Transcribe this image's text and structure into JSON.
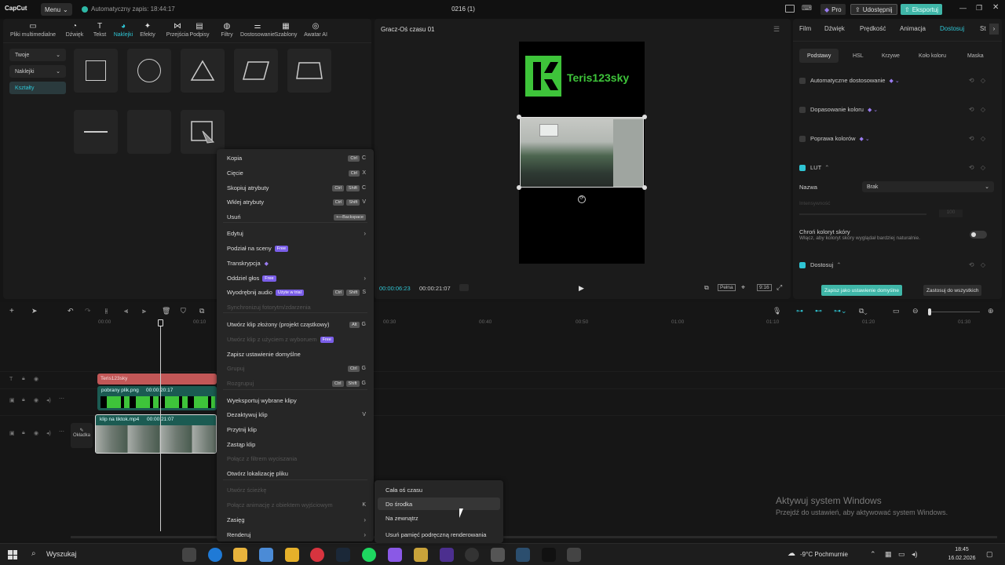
{
  "app": {
    "logo": "CapCut",
    "menu_label": "Menu",
    "autosave": "Automatyczny zapis: 18:44:17",
    "window_title": "0216 (1)",
    "pro_label": "Pro",
    "share_label": "Udostępnij",
    "export_label": "Eksportuj"
  },
  "tools": [
    {
      "label": "Pliki multimedialne",
      "icon": "media-icon"
    },
    {
      "label": "Dźwięk",
      "icon": "audio-icon"
    },
    {
      "label": "Tekst",
      "icon": "text-icon"
    },
    {
      "label": "Naklejki",
      "icon": "sticker-icon"
    },
    {
      "label": "Efekty",
      "icon": "effects-icon"
    },
    {
      "label": "Przejścia",
      "icon": "transitions-icon"
    },
    {
      "label": "Podpisy",
      "icon": "captions-icon"
    },
    {
      "label": "Filtry",
      "icon": "filters-icon"
    },
    {
      "label": "Dostosowanie",
      "icon": "adjust-icon"
    },
    {
      "label": "Szablony",
      "icon": "templates-icon"
    },
    {
      "label": "Awatar AI",
      "icon": "avatar-icon"
    }
  ],
  "sidebar": [
    {
      "label": "Twoje"
    },
    {
      "label": "Naklejki"
    },
    {
      "label": "Kształty"
    }
  ],
  "player": {
    "title": "Gracz-Oś czasu 01",
    "current_time": "00:00:06:23",
    "total_time": "00:00:21:07",
    "ratio": "9:16",
    "ratio_btn": "Pełna",
    "watermark": "Teris123sky"
  },
  "right": {
    "tabs": [
      "Film",
      "Dźwięk",
      "Prędkość",
      "Animacja",
      "Dostosuj",
      "St"
    ],
    "subtabs": [
      "Podstawy",
      "HSL",
      "Krzywe",
      "Koło koloru",
      "Maska"
    ],
    "rows": [
      {
        "label": "Automatyczne dostosowanie"
      },
      {
        "label": "Dopasowanie koloru"
      },
      {
        "label": "Poprawa kolorów"
      },
      {
        "label": "LUT"
      }
    ],
    "name_label": "Nazwa",
    "name_value": "Brak",
    "intensity_label": "Intensywność",
    "intensity_value": "100",
    "skin_title": "Chroń koloryt skóry",
    "skin_desc": "Włącz, aby koloryt skóry wyglądał bardziej naturalnie.",
    "adjust_label": "Dostosuj",
    "save_default": "Zapisz jako ustawienie domyślne",
    "apply_all": "Zastosuj do wszystkich"
  },
  "timeline": {
    "ticks": [
      "00:00",
      "00:10",
      "00:30",
      "00:40",
      "00:50",
      "01:00",
      "01:10",
      "01:20",
      "01:30"
    ],
    "text_clip": "Teris123sky",
    "image_clip": {
      "name": "pobrany plik.png",
      "duration": "00:00:20:17"
    },
    "video_clip": {
      "name": "klip na tiktok.mp4",
      "duration": "00:00:21:07"
    },
    "cover_label": "Okładka"
  },
  "context_menu": [
    {
      "label": "Kopia",
      "keys": [
        "Ctrl",
        "C"
      ]
    },
    {
      "label": "Cięcie",
      "keys": [
        "Ctrl",
        "X"
      ]
    },
    {
      "label": "Skopiuj atrybuty",
      "keys": [
        "Ctrl",
        "Shift",
        "C"
      ]
    },
    {
      "label": "Wklej atrybuty",
      "keys": [
        "Ctrl",
        "Shift",
        "V"
      ]
    },
    {
      "label": "Usuń",
      "keys": [
        "⟵Backspace"
      ]
    },
    {
      "label": "Edytuj"
    },
    {
      "label": "Podział na sceny",
      "badge": "Free"
    },
    {
      "label": "Transkrypcja"
    },
    {
      "label": "Oddziel głos",
      "badge": "Free"
    },
    {
      "label": "Wyodrębnij audio",
      "badge": "Użyte w trial",
      "keys": [
        "Ctrl",
        "Shift",
        "S"
      ]
    },
    {
      "label": "Synchronizuj fotorytm/zdarzenia"
    },
    {
      "label": "Utwórz klip złożony (projekt cząstkowy)",
      "keys": [
        "Alt",
        "G"
      ]
    },
    {
      "label": "Utwórz klip z użyciem z wyboruem",
      "badge": "Free"
    },
    {
      "label": "Zapisz ustawienie domyślne"
    },
    {
      "label": "Grupuj",
      "keys": [
        "Ctrl",
        "G"
      ]
    },
    {
      "label": "Rozgrupuj",
      "keys": [
        "Ctrl",
        "Shift",
        "G"
      ]
    },
    {
      "label": "Wyeksportuj wybrane klipy"
    },
    {
      "label": "Dezaktywuj klip",
      "keys": [
        "V"
      ]
    },
    {
      "label": "Przytnij klip"
    },
    {
      "label": "Zastąp klip"
    },
    {
      "label": "Połącz z filtrem wyciszania"
    },
    {
      "label": "Otwórz lokalizację pliku"
    },
    {
      "label": "Utwórz ścieżkę"
    },
    {
      "label": "Połącz animację z obiektem wyjściowym",
      "keys": [
        "K"
      ]
    },
    {
      "label": "Zasięg"
    },
    {
      "label": "Renderuj"
    }
  ],
  "render_submenu": [
    "Cała oś czasu",
    "Do środka",
    "Na zewnątrz",
    "Usuń pamięć podręczną renderowania"
  ],
  "windows": {
    "activate_title": "Aktywuj system Windows",
    "activate_desc": "Przejdź do ustawień, aby aktywować system Windows."
  },
  "taskbar": {
    "search": "Wyszukaj",
    "weather": "-9°C  Pochmurnie",
    "time": "18:45",
    "date": "16.02.2026"
  }
}
